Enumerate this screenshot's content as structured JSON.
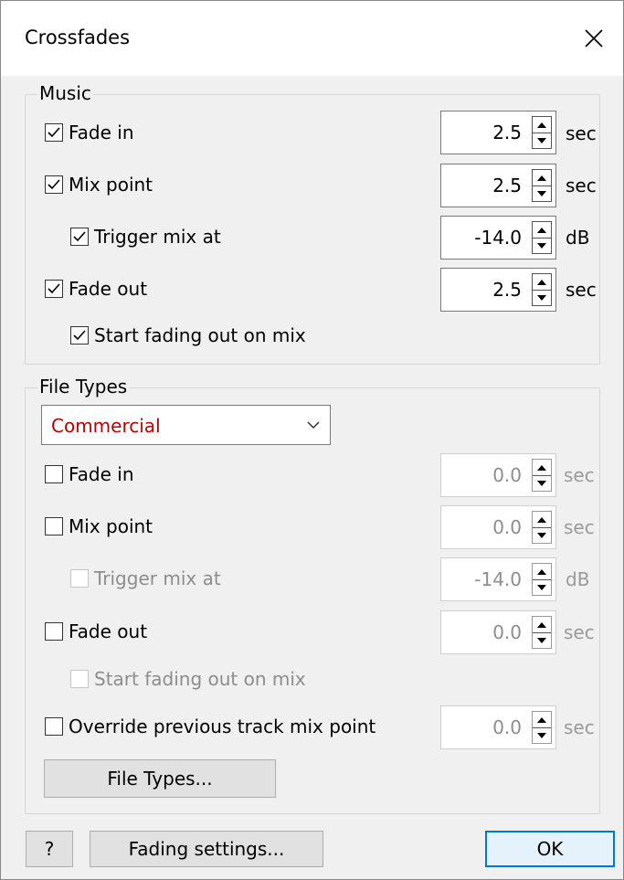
{
  "window": {
    "title": "Crossfades"
  },
  "music": {
    "legend": "Music",
    "fade_in": {
      "label": "Fade in",
      "checked": true,
      "value": "2.5",
      "unit": "sec"
    },
    "mix_point": {
      "label": "Mix point",
      "checked": true,
      "value": "2.5",
      "unit": "sec"
    },
    "trigger_mix": {
      "label": "Trigger mix at",
      "checked": true,
      "value": "-14.0",
      "unit": "dB"
    },
    "fade_out": {
      "label": "Fade out",
      "checked": true,
      "value": "2.5",
      "unit": "sec"
    },
    "start_fading": {
      "label": "Start fading out on mix",
      "checked": true
    }
  },
  "file_types": {
    "legend": "File Types",
    "selected_type": "Commercial",
    "fade_in": {
      "label": "Fade in",
      "checked": false,
      "value": "0.0",
      "unit": "sec"
    },
    "mix_point": {
      "label": "Mix point",
      "checked": false,
      "value": "0.0",
      "unit": "sec"
    },
    "trigger_mix": {
      "label": "Trigger mix at",
      "checked": false,
      "value": "-14.0",
      "unit": "dB"
    },
    "fade_out": {
      "label": "Fade out",
      "checked": false,
      "value": "0.0",
      "unit": "sec"
    },
    "start_fading": {
      "label": "Start fading out on mix",
      "checked": false
    },
    "override": {
      "label": "Override previous track mix point",
      "checked": false,
      "value": "0.0",
      "unit": "sec"
    },
    "button_label": "File Types..."
  },
  "footer": {
    "help_label": "?",
    "fading_settings_label": "Fading settings...",
    "ok_label": "OK"
  },
  "colors": {
    "accent": "#0078d7",
    "type_text": "#c00000"
  }
}
